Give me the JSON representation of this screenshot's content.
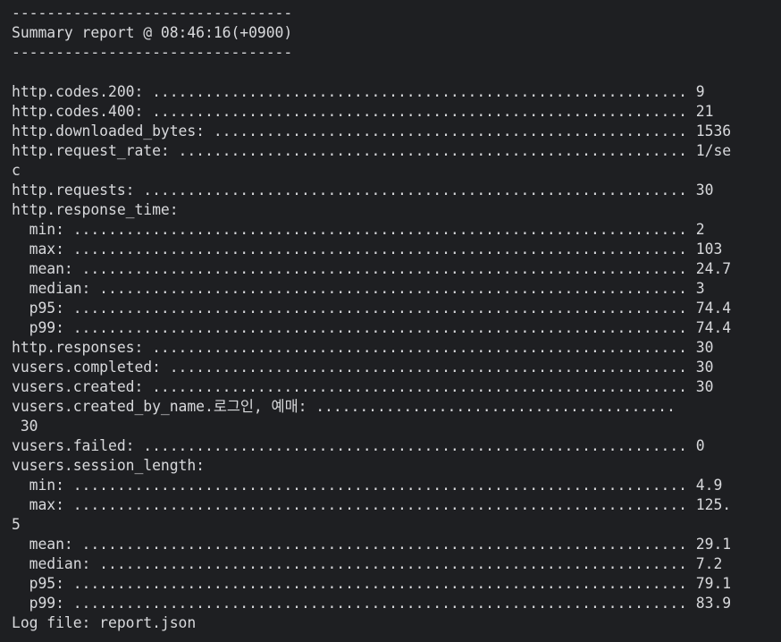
{
  "terminal": {
    "lines": [
      "--------------------------------",
      "Summary report @ 08:46:16(+0900)",
      "--------------------------------",
      "",
      "http.codes.200: ............................................................. 9",
      "http.codes.400: ............................................................. 21",
      "http.downloaded_bytes: ...................................................... 1536",
      "http.request_rate: .......................................................... 1/se",
      "c",
      "http.requests: .............................................................. 30",
      "http.response_time:",
      "  min: ...................................................................... 2",
      "  max: ...................................................................... 103",
      "  mean: ..................................................................... 24.7",
      "  median: ................................................................... 3",
      "  p95: ...................................................................... 74.4",
      "  p99: ...................................................................... 74.4",
      "http.responses: ............................................................. 30",
      "vusers.completed: ........................................................... 30",
      "vusers.created: ............................................................. 30",
      "vusers.created_by_name.로그인, 예매: .........................................",
      " 30",
      "vusers.failed: .............................................................. 0",
      "vusers.session_length:",
      "  min: ...................................................................... 4.9",
      "  max: ...................................................................... 125.",
      "5",
      "  mean: ..................................................................... 29.1",
      "  median: ................................................................... 7.2",
      "  p95: ...................................................................... 79.1",
      "  p99: ...................................................................... 83.9",
      "Log file: report.json"
    ]
  }
}
